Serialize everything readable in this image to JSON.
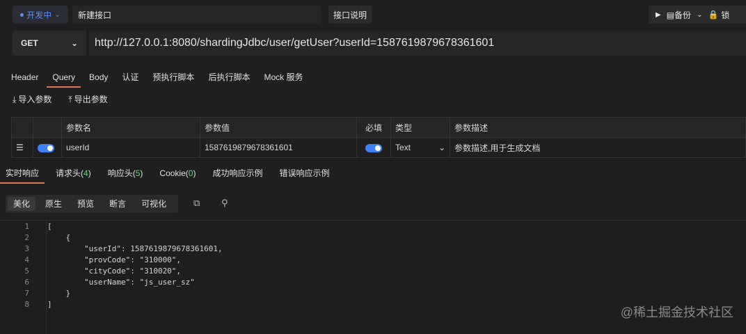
{
  "header": {
    "status": "开发中",
    "name": "新建接口",
    "doc_button": "接口说明",
    "backup_label": "备份",
    "cut_text": "锁"
  },
  "request": {
    "method": "GET",
    "url": "http://127.0.0.1:8080/shardingJdbc/user/getUser?userId=1587619879678361601"
  },
  "tabs": [
    "Header",
    "Query",
    "Body",
    "认证",
    "预执行脚本",
    "后执行脚本",
    "Mock 服务"
  ],
  "params_actions": {
    "import": "导入参数",
    "export": "导出参数"
  },
  "params_table": {
    "headers": [
      "参数名",
      "参数值",
      "必填",
      "类型",
      "参数描述"
    ],
    "row": {
      "name": "userId",
      "value": "1587619879678361601",
      "type": "Text",
      "desc_placeholder": "参数描述,用于生成文档"
    }
  },
  "response_tabs": [
    {
      "label": "实时响应"
    },
    {
      "label": "请求头",
      "count": "4"
    },
    {
      "label": "响应头",
      "count": "5"
    },
    {
      "label": "Cookie",
      "count": "0"
    },
    {
      "label": "成功响应示例"
    },
    {
      "label": "错误响应示例"
    }
  ],
  "view_modes": [
    "美化",
    "原生",
    "预览",
    "断言",
    "可视化"
  ],
  "code_lines": [
    "[",
    "    {",
    "        \"userId\": 1587619879678361601,",
    "        \"provCode\": \"310000\",",
    "        \"cityCode\": \"310020\",",
    "        \"userName\": \"js_user_sz\"",
    "    }",
    "]"
  ],
  "watermark": "@稀土掘金技术社区"
}
